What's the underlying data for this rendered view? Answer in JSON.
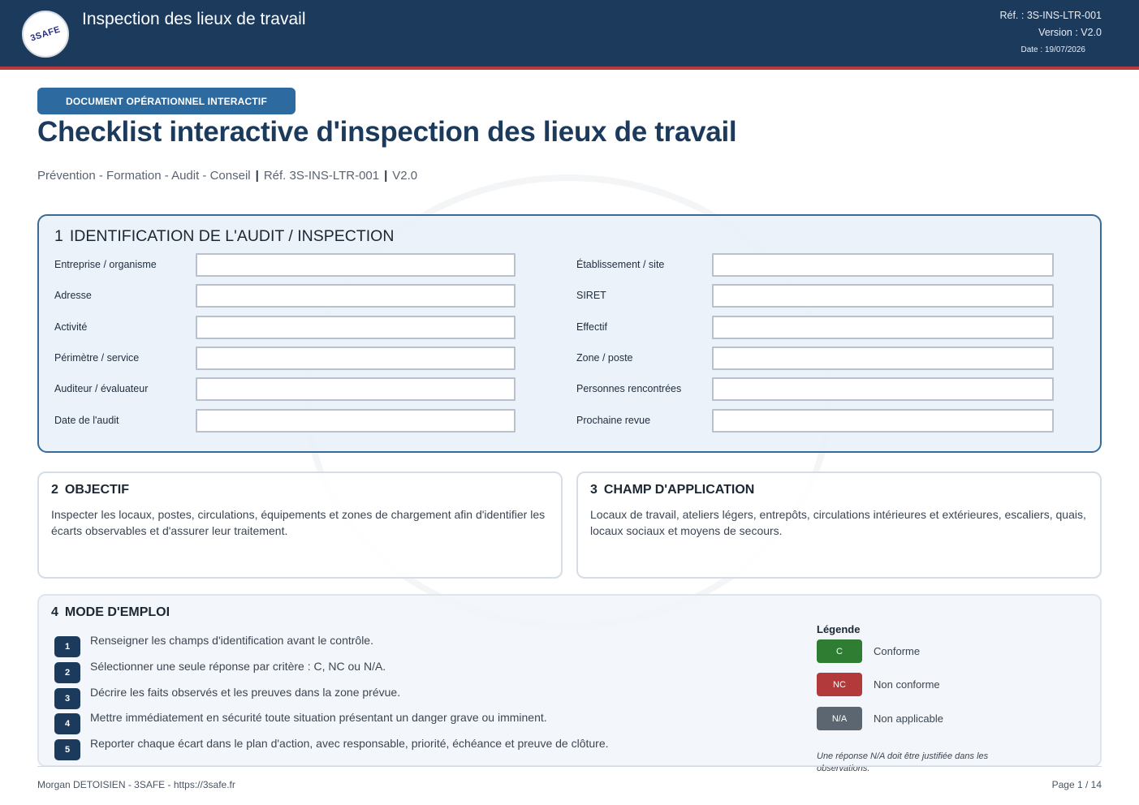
{
  "header": {
    "logo_text": "3SAFE",
    "app_title": "Inspection des lieux de travail",
    "ref": "Réf. : 3S-INS-LTR-001",
    "version": "Version : V2.0",
    "date": "Date : 19/07/2026"
  },
  "doc": {
    "badge": "DOCUMENT OPÉRATIONNEL INTERACTIF",
    "title": "Checklist interactive d'inspection des lieux de travail",
    "subtitle_parts": [
      "Prévention - Formation - Audit - Conseil",
      "Réf. 3S-INS-LTR-001",
      "V2.0"
    ],
    "subtitle_separator": "|"
  },
  "identification": {
    "number": "1",
    "title": "IDENTIFICATION DE L'AUDIT / INSPECTION",
    "left_fields": [
      {
        "label": "Entreprise / organisme",
        "value": ""
      },
      {
        "label": "Adresse",
        "value": ""
      },
      {
        "label": "Activité",
        "value": ""
      },
      {
        "label": "Périmètre / service",
        "value": ""
      },
      {
        "label": "Auditeur / évaluateur",
        "value": ""
      },
      {
        "label": "Date de l'audit",
        "value": ""
      }
    ],
    "right_fields": [
      {
        "label": "Établissement / site",
        "value": ""
      },
      {
        "label": "SIRET",
        "value": ""
      },
      {
        "label": "Effectif",
        "value": ""
      },
      {
        "label": "Zone / poste",
        "value": ""
      },
      {
        "label": "Personnes rencontrées",
        "value": ""
      },
      {
        "label": "Prochaine revue",
        "value": ""
      }
    ]
  },
  "objectif": {
    "number": "2",
    "title": "OBJECTIF",
    "text": "Inspecter les locaux, postes, circulations, équipements et zones de chargement afin d'identifier les écarts observables et d'assurer leur traitement."
  },
  "champ": {
    "number": "3",
    "title": "CHAMP D'APPLICATION",
    "text": "Locaux de travail, ateliers légers, entrepôts, circulations intérieures et extérieures, escaliers, quais, locaux sociaux et moyens de secours."
  },
  "mode_emploi": {
    "number": "4",
    "title": "MODE D'EMPLOI",
    "steps": [
      {
        "num": "1",
        "text": "Renseigner les champs d'identification avant le contrôle."
      },
      {
        "num": "2",
        "text": "Sélectionner une seule réponse par critère : C, NC ou N/A."
      },
      {
        "num": "3",
        "text": "Décrire les faits observés et les preuves dans la zone prévue."
      },
      {
        "num": "4",
        "text": "Mettre immédiatement en sécurité toute situation présentant un danger grave ou imminent."
      },
      {
        "num": "5",
        "text": "Reporter chaque écart dans le plan d'action, avec responsable, priorité, échéance et preuve de clôture."
      }
    ],
    "legend": {
      "title": "Légende",
      "items": [
        {
          "code": "C",
          "label": "Conforme",
          "color": "#2e7d32"
        },
        {
          "code": "NC",
          "label": "Non conforme",
          "color": "#b23a3a"
        },
        {
          "code": "N/A",
          "label": "Non applicable",
          "color": "#5b6670"
        }
      ],
      "note": "Une réponse N/A doit être justifiée dans les observations."
    }
  },
  "footer": {
    "left": "Morgan DETOISIEN - 3SAFE - https://3safe.fr",
    "right": "Page 1 / 14"
  },
  "colors": {
    "header_bg": "#1b3a5c",
    "header_accent": "#b83a3f",
    "badge_bg": "#2d6a9f"
  }
}
